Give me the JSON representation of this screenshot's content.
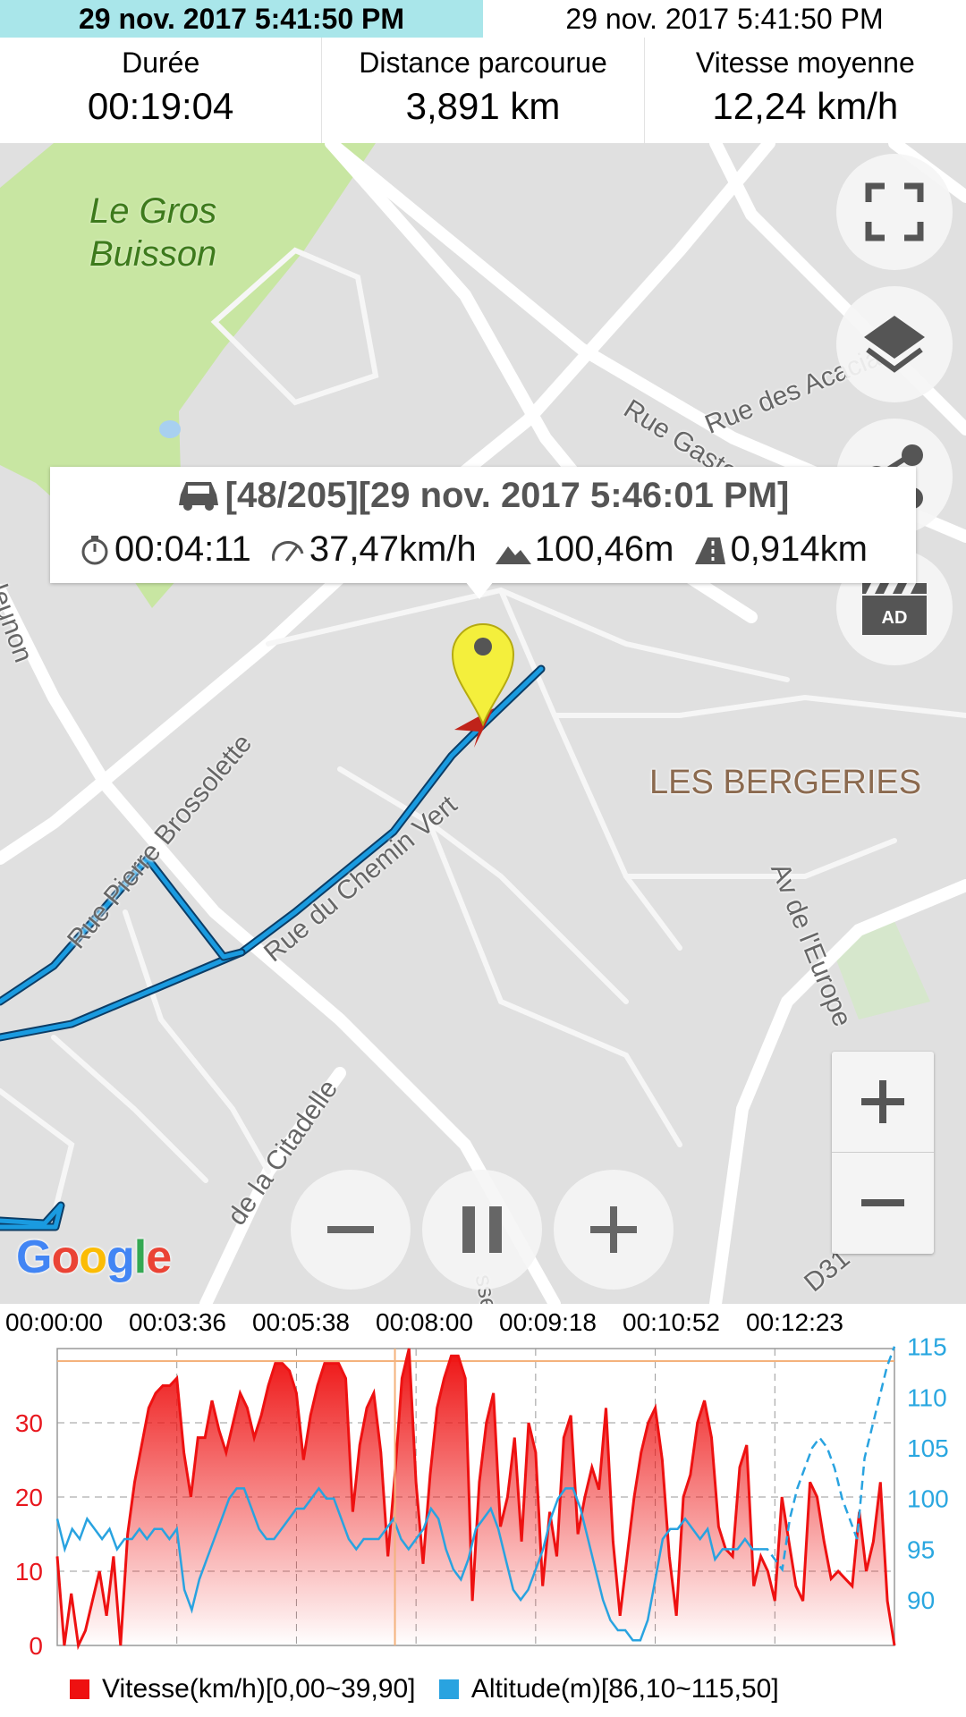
{
  "header": {
    "selected_time": "29 nov. 2017 5:41:50 PM",
    "current_time": "29 nov. 2017 5:41:50 PM"
  },
  "stats": [
    {
      "label": "Durée",
      "value": "00:19:04"
    },
    {
      "label": "Distance parcourue",
      "value": "3,891 km"
    },
    {
      "label": "Vitesse moyenne",
      "value": "12,24 km/h"
    }
  ],
  "map": {
    "labels": {
      "park": "Le Gros\nBuisson",
      "district": "LES BERGERIES",
      "rue_acacias": "Rue des Acacia",
      "rue_gaston": "Rue Gaston",
      "rue_pierre_brossolette": "Rue Pierre Brossolette",
      "rue_chemin_vert": "Rue du Chemin Vert",
      "rue_citadelle": "de la Citadelle",
      "av_europe": "Av de l'Europe",
      "d31": "D31",
      "neunon": "leunon",
      "vert_small": "sser"
    },
    "google_logo": "Google",
    "popup": {
      "title": "[48/205][29 nov. 2017 5:46:01 PM]",
      "elapsed": "00:04:11",
      "speed": "37,47km/h",
      "altitude": "100,46m",
      "distance": "0,914km"
    },
    "buttons": {
      "fullscreen": "fullscreen-icon",
      "layers": "layers-icon",
      "share": "share-icon",
      "ad": "AD",
      "zoom_in": "+",
      "zoom_out": "−"
    },
    "playback": {
      "slower": "−",
      "pause": "pause-icon",
      "faster": "+"
    },
    "colors": {
      "track": "#1a9be0",
      "park": "#c8e6a2",
      "road": "#ffffff",
      "pin": "#f4ef3c"
    }
  },
  "chart_data": {
    "type": "area",
    "x_tick_labels": [
      "00:00:00",
      "00:03:36",
      "00:05:38",
      "00:08:00",
      "00:09:18",
      "00:10:52",
      "00:12:23"
    ],
    "left_axis": {
      "ticks": [
        0,
        10,
        20,
        30
      ],
      "ylim": [
        0,
        40
      ],
      "color": "#e8171e"
    },
    "right_axis": {
      "ticks": [
        90,
        95,
        100,
        105,
        110,
        115
      ],
      "ylim": [
        85.5,
        114.8
      ],
      "color": "#2aa7e0"
    },
    "grid": true,
    "legend_position": "bottom",
    "cursor_index": 48,
    "series": [
      {
        "name": "Vitesse(km/h)[0,00~39,90]",
        "color": "#ee1111",
        "values": [
          12,
          0,
          7,
          0,
          2,
          6,
          10,
          4,
          12,
          0,
          15,
          22,
          27,
          32,
          34,
          35,
          35,
          36,
          26,
          20,
          28,
          28,
          33,
          29,
          26,
          30,
          34,
          32,
          28,
          31,
          35,
          38,
          38,
          37,
          34,
          25,
          31,
          35,
          38,
          38,
          38,
          36,
          18,
          27,
          32,
          34,
          26,
          12,
          23,
          36,
          40,
          22,
          11,
          23,
          32,
          36,
          39,
          39,
          36,
          6,
          22,
          30,
          34,
          16,
          20,
          28,
          14,
          30,
          26,
          8,
          18,
          12,
          28,
          31,
          15,
          20,
          24,
          21,
          32,
          14,
          4,
          12,
          20,
          26,
          30,
          32,
          25,
          12,
          4,
          20,
          23,
          30,
          33,
          28,
          16,
          13,
          12,
          24,
          27,
          8,
          12,
          10,
          6,
          20,
          14,
          8,
          6,
          22,
          20,
          14,
          9,
          10,
          9,
          8,
          18,
          10,
          14,
          22,
          6,
          0
        ]
      },
      {
        "name": "Altitude(m)[86,10~115,50]",
        "color": "#29a3e0",
        "values": [
          98,
          95,
          97,
          96,
          98,
          97,
          96,
          97,
          95,
          96,
          96,
          97,
          96,
          97,
          97,
          96,
          97,
          91,
          89,
          92,
          94,
          96,
          98,
          100,
          101,
          101,
          99,
          97,
          96,
          96,
          97,
          98,
          99,
          99,
          100,
          101,
          100,
          100,
          98,
          96,
          95,
          96,
          96,
          96,
          97,
          98,
          96,
          95,
          96,
          97,
          99,
          98,
          95,
          93,
          92,
          94,
          97,
          98,
          99,
          97,
          94,
          91,
          90,
          91,
          93,
          95,
          98,
          100,
          101,
          101,
          99,
          96,
          93,
          90,
          88,
          87,
          87,
          86,
          86,
          88,
          92,
          96,
          97,
          97,
          98,
          97,
          96,
          97,
          94,
          95,
          95,
          95,
          96,
          95,
          95,
          95,
          94,
          93,
          98,
          101,
          103,
          105,
          106,
          105,
          103,
          100,
          98,
          96,
          104,
          107,
          110,
          113,
          115
        ]
      }
    ]
  }
}
